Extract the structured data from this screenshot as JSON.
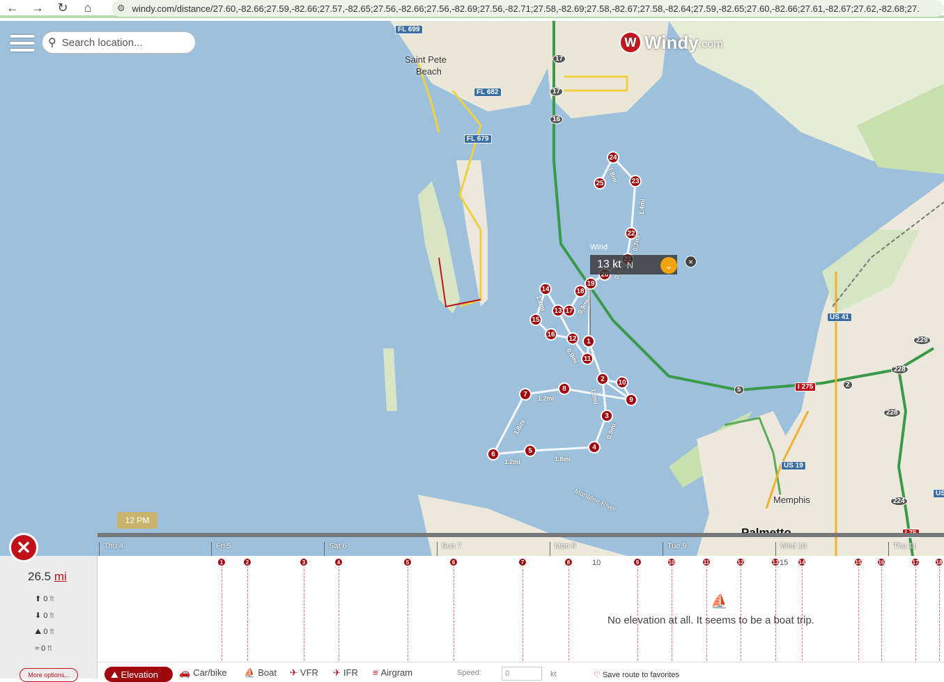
{
  "browser": {
    "back_icon": "arrow-left-icon",
    "url": "windy.com/distance/27.60,-82.66;27.59,-82.66;27.57,-82.65;27.56,-82.66;27.56,-82.69;27.56,-82.71;27.58,-82.69;27.58,-82.67;27.58,-82.64;27.59,-82.65;27.60,-82.66;27.61,-82.67;27.62,-82.68;27.",
    "glyphs": {
      "back": "←",
      "forward": "→",
      "reload": "↻",
      "home": "⌂",
      "site": "⚙"
    }
  },
  "search": {
    "placeholder": "Search location...",
    "glyph": "⚲"
  },
  "logo": {
    "text": "Windy",
    "suffix": ".com",
    "glyph": "W"
  },
  "map": {
    "places": [
      "Saint Pete",
      "Beach",
      "Memphis",
      "Palmetto",
      "Manatee River"
    ],
    "shields": [
      "FL 699",
      "FL 682",
      "FL 679",
      "US 41",
      "I 275",
      "US 19",
      "I 75",
      "17",
      "17",
      "16",
      "5",
      "2",
      "229",
      "228",
      "228",
      "224",
      "US"
    ],
    "waypoints": [
      "1",
      "2",
      "3",
      "4",
      "5",
      "6",
      "7",
      "8",
      "9",
      "10",
      "11",
      "12",
      "13",
      "14",
      "15",
      "16",
      "17",
      "18",
      "19",
      "20",
      "21",
      "22",
      "23",
      "24",
      "25"
    ],
    "distances": [
      "1.2mi",
      "1.8mi",
      "1.8mi",
      "1.2mi",
      "1.8mi",
      "0.9mi",
      "1.8mi",
      "1.4mi",
      "0.7mi",
      "0.9mi",
      "0.9mi",
      "0.7mi",
      "1.2mi"
    ]
  },
  "wind": {
    "label": "Wind",
    "value": "13 kt",
    "direction": "N",
    "dropdown": "⌄",
    "close": "×"
  },
  "timeline": {
    "tooltip": "12 PM",
    "days": [
      "Thu 4",
      "Fri 5",
      "Sat 6",
      "Sun 7",
      "Mon 8",
      "Tue 9",
      "Wed 10",
      "Thu 11"
    ]
  },
  "route": {
    "close_glyph": "✕",
    "distance_value": "26.5",
    "distance_unit": "mi",
    "stats": [
      {
        "glyph": "⬆",
        "value": "0",
        "unit": "ft"
      },
      {
        "glyph": "⬇",
        "value": "0",
        "unit": "ft"
      },
      {
        "glyph": "⛰",
        "value": "0",
        "unit": "ft"
      },
      {
        "glyph": "≈",
        "value": "0",
        "unit": "ft"
      }
    ],
    "more_options": "More options..."
  },
  "profile": {
    "message": "No elevation at all. It seems to be a boat trip.",
    "boat_glyph": "⛵",
    "tick_labels": [
      "10",
      "15"
    ],
    "markers": [
      "1",
      "2",
      "3",
      "4",
      "5",
      "6",
      "7",
      "8",
      "9",
      "10",
      "11",
      "12",
      "13",
      "14",
      "15",
      "16",
      "17",
      "18"
    ]
  },
  "tabs": {
    "elevation": "Elevation",
    "car": "Car/bike",
    "boat": "Boat",
    "vfr": "VFR",
    "ifr": "IFR",
    "airgram": "Airgram",
    "glyphs": {
      "elevation": "⛰",
      "car": "🚗",
      "boat": "⛵",
      "vfr": "✈",
      "ifr": "✈",
      "airgram": "≡",
      "heart": "♡"
    }
  },
  "speed": {
    "label": "Speed:",
    "value": "0",
    "unit": "kt"
  },
  "save_route": "Save route to favorites"
}
